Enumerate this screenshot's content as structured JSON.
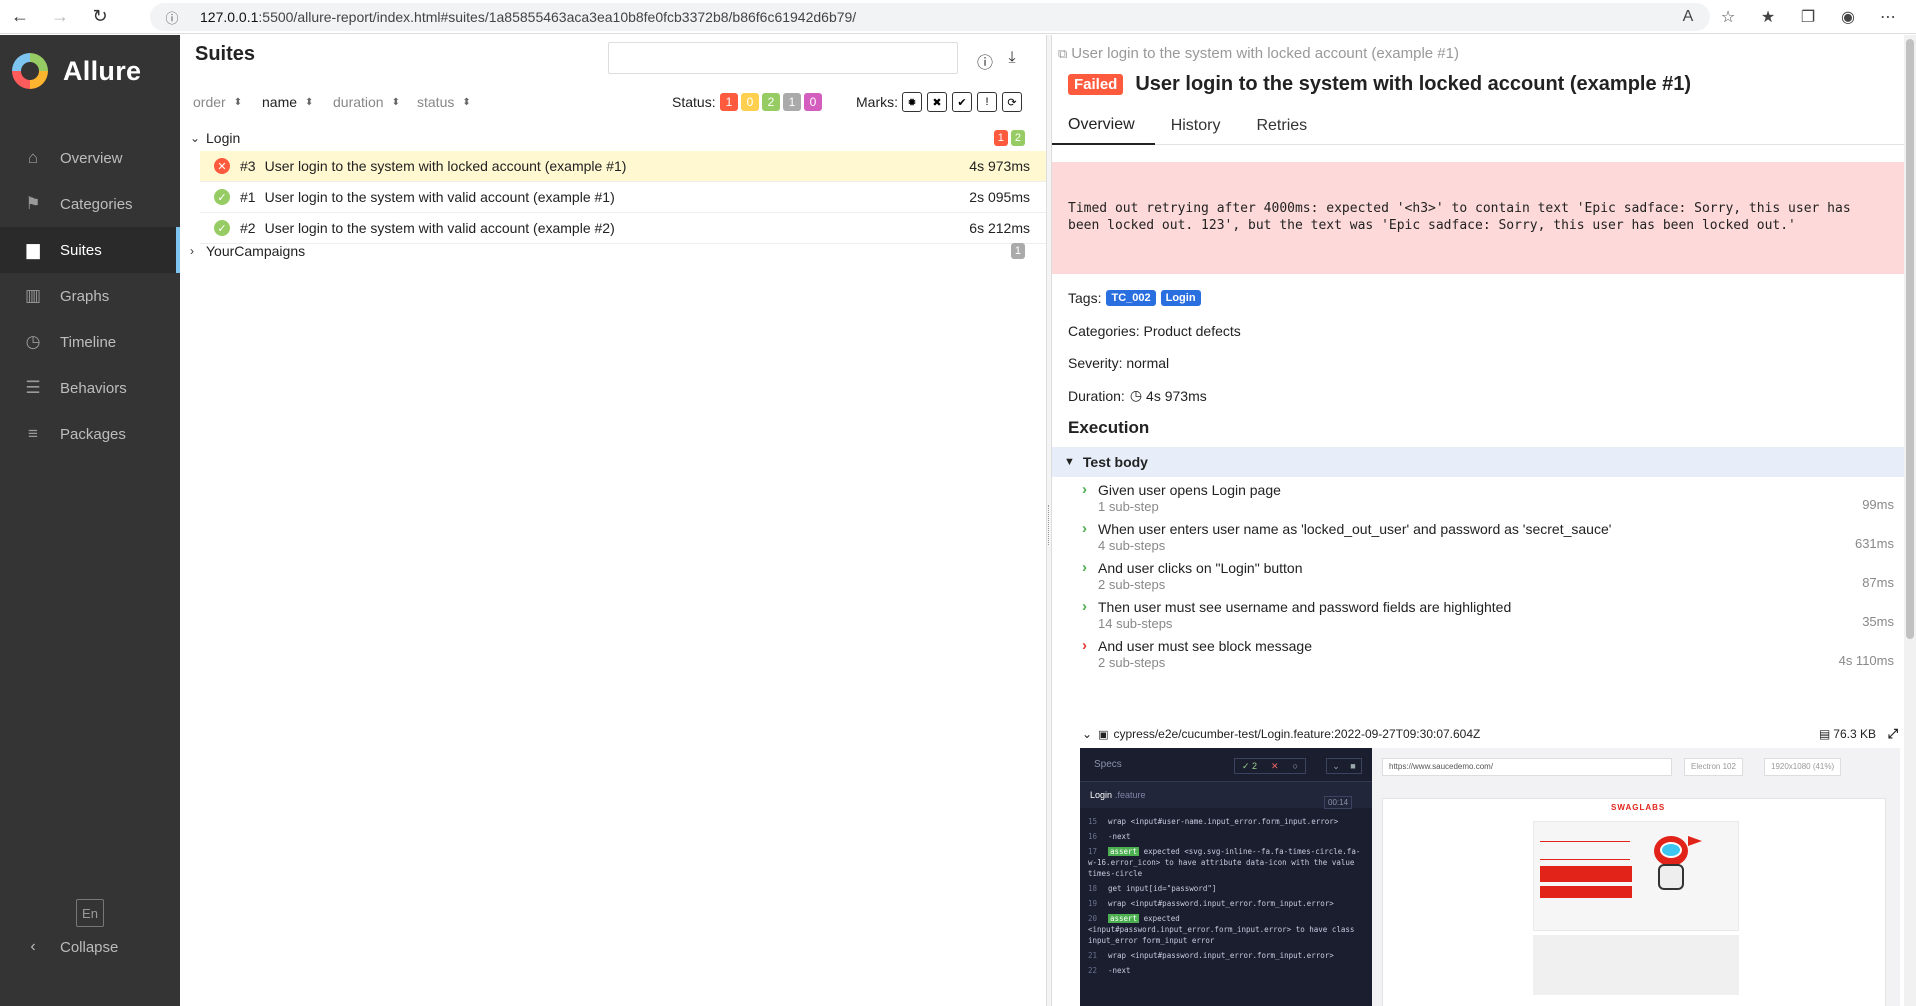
{
  "browser": {
    "url_host": "127.0.0.1",
    "url_rest": ":5500/allure-report/index.html#suites/1a85855463aca3ea10b8fe0fcb3372b8/b86f6c61942d6b79/"
  },
  "sidebar": {
    "brand": "Allure",
    "items": [
      {
        "label": "Overview",
        "icon": "home-icon",
        "glyph": "⌂"
      },
      {
        "label": "Categories",
        "icon": "flag-icon",
        "glyph": "⚑"
      },
      {
        "label": "Suites",
        "icon": "briefcase-icon",
        "glyph": "▆"
      },
      {
        "label": "Graphs",
        "icon": "bar-chart-icon",
        "glyph": "▥"
      },
      {
        "label": "Timeline",
        "icon": "clock-icon",
        "glyph": "◷"
      },
      {
        "label": "Behaviors",
        "icon": "list-icon",
        "glyph": "☰"
      },
      {
        "label": "Packages",
        "icon": "align-left-icon",
        "glyph": "≡"
      }
    ],
    "active": "Suites",
    "language": "En",
    "collapse": "Collapse"
  },
  "suites": {
    "title": "Suites",
    "search_value": "",
    "sort": {
      "order": "order",
      "name": "name",
      "duration": "duration",
      "status": "status"
    },
    "status_label": "Status:",
    "status_counts": [
      "1",
      "0",
      "2",
      "1",
      "0"
    ],
    "marks_label": "Marks:",
    "groups": [
      {
        "name": "Login",
        "counts": {
          "failed": "1",
          "passed": "2"
        },
        "expanded": true,
        "rows": [
          {
            "num": "#3",
            "name": "User login to the system with locked account (example #1)",
            "duration": "4s 973ms",
            "status": "failed"
          },
          {
            "num": "#1",
            "name": "User login to the system with valid account (example #1)",
            "duration": "2s 095ms",
            "status": "passed"
          },
          {
            "num": "#2",
            "name": "User login to the system with valid account (example #2)",
            "duration": "6s 212ms",
            "status": "passed"
          }
        ]
      },
      {
        "name": "YourCampaigns",
        "counts": {
          "unknown": "1"
        },
        "expanded": false,
        "rows": []
      }
    ]
  },
  "detail": {
    "breadcrumb": "User login to the system with locked account (example #1)",
    "status_label": "Failed",
    "title": "User login to the system with locked account (example #1)",
    "tabs": [
      "Overview",
      "History",
      "Retries"
    ],
    "error_message": "Timed out retrying after 4000ms: expected '<h3>' to contain text 'Epic sadface: Sorry, this user has been locked out. 123', but the text was 'Epic sadface: Sorry, this user has been locked out.'",
    "tags_label": "Tags:",
    "tags": [
      "TC_002",
      "Login"
    ],
    "categories": "Categories: Product defects",
    "severity": "Severity: normal",
    "duration_label": "Duration:",
    "duration": "4s 973ms",
    "execution_title": "Execution",
    "test_body": "Test body",
    "steps": [
      {
        "name": "Given user opens Login page",
        "sub": "1 sub-step",
        "duration": "99ms",
        "status": "passed"
      },
      {
        "name": "When user enters user name as 'locked_out_user' and password as 'secret_sauce'",
        "sub": "4 sub-steps",
        "duration": "631ms",
        "status": "passed"
      },
      {
        "name": "And user clicks on \"Login\" button",
        "sub": "2 sub-steps",
        "duration": "87ms",
        "status": "passed"
      },
      {
        "name": "Then user must see username and password fields are highlighted",
        "sub": "14 sub-steps",
        "duration": "35ms",
        "status": "passed"
      },
      {
        "name": "And user must see block message",
        "sub": "2 sub-steps",
        "duration": "4s 110ms",
        "status": "failed"
      }
    ],
    "attachment": {
      "name": "cypress/e2e/cucumber-test/Login.feature:2022-09-27T09:30:07.604Z",
      "size": "76.3 KB"
    },
    "screenshot": {
      "specs_label": "Specs",
      "pass_count": "2",
      "feature": "Login",
      "feature_ext": ".feature",
      "time": "00:14",
      "url": "https://www.saucedemo.com/",
      "browser": "Electron 102",
      "viewport": "1920x1080 (41%)",
      "logo": "SWAGLABS",
      "log": [
        {
          "ln": "15",
          "text": "wrap  <input#user-name.input_error.form_input.error>"
        },
        {
          "ln": "16",
          "text": "-next"
        },
        {
          "ln": "17",
          "assert": "assert",
          "text": "expected <svg.svg-inline--fa.fa-times-circle.fa-w-16.error_icon> to have attribute data-icon with the value times-circle"
        },
        {
          "ln": "18",
          "text": "get  input[id=\"password\"]"
        },
        {
          "ln": "19",
          "text": "wrap  <input#password.input_error.form_input.error>"
        },
        {
          "ln": "20",
          "assert": "assert",
          "text": "expected <input#password.input_error.form_input.error> to have class input_error form_input error"
        },
        {
          "ln": "21",
          "text": "wrap  <input#password.input_error.form_input.error>"
        },
        {
          "ln": "22",
          "text": "-next"
        }
      ]
    }
  }
}
